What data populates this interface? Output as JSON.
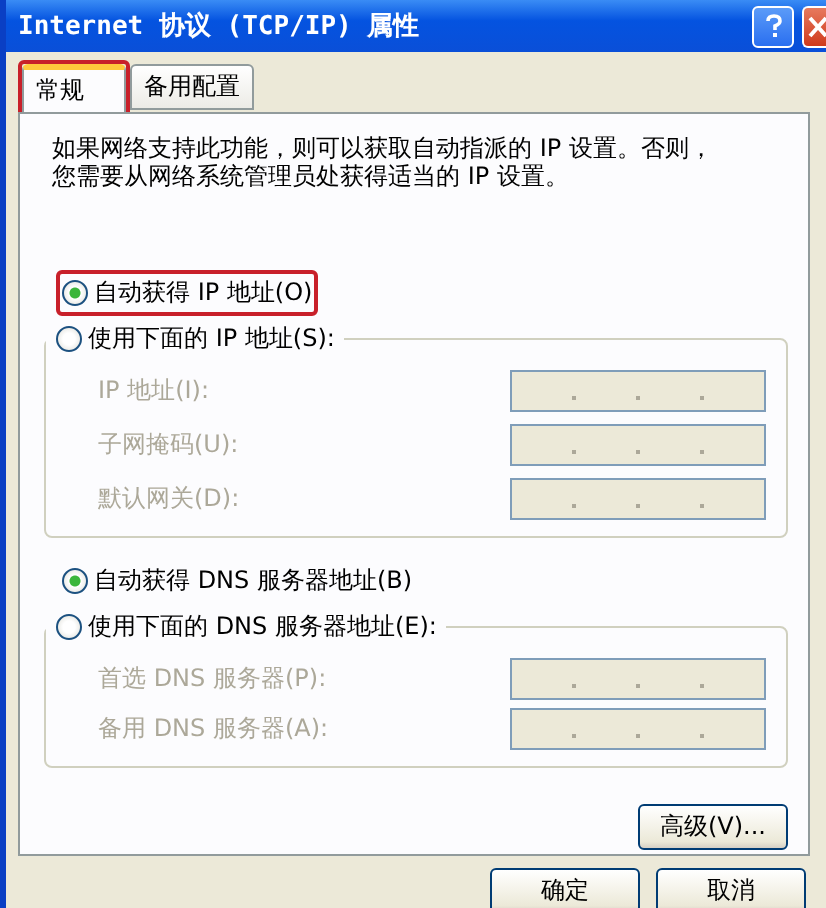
{
  "window": {
    "title": "Internet 协议 (TCP/IP) 属性"
  },
  "tabs": [
    {
      "label": "常规",
      "selected": true,
      "highlighted": true
    },
    {
      "label": "备用配置",
      "selected": false,
      "highlighted": false
    }
  ],
  "description": "如果网络支持此功能，则可以获取自动指派的 IP 设置。否则，您需要从网络系统管理员处获得适当的 IP 设置。",
  "ip_section": {
    "options": [
      {
        "label": "自动获得 IP 地址(O)",
        "selected": true,
        "highlighted": true
      },
      {
        "label": "使用下面的 IP 地址(S):",
        "selected": false,
        "highlighted": false
      }
    ],
    "fields": [
      {
        "label": "IP 地址(I):",
        "disabled": true
      },
      {
        "label": "子网掩码(U):",
        "disabled": true
      },
      {
        "label": "默认网关(D):",
        "disabled": true
      }
    ]
  },
  "dns_section": {
    "options": [
      {
        "label": "自动获得 DNS 服务器地址(B)",
        "selected": true,
        "highlighted": false
      },
      {
        "label": "使用下面的 DNS 服务器地址(E):",
        "selected": false,
        "highlighted": false
      }
    ],
    "fields": [
      {
        "label": "首选 DNS 服务器(P):",
        "disabled": true
      },
      {
        "label": "备用 DNS 服务器(A):",
        "disabled": true
      }
    ]
  },
  "advanced_button": "高级(V)...",
  "buttons": [
    "确定",
    "取消"
  ]
}
